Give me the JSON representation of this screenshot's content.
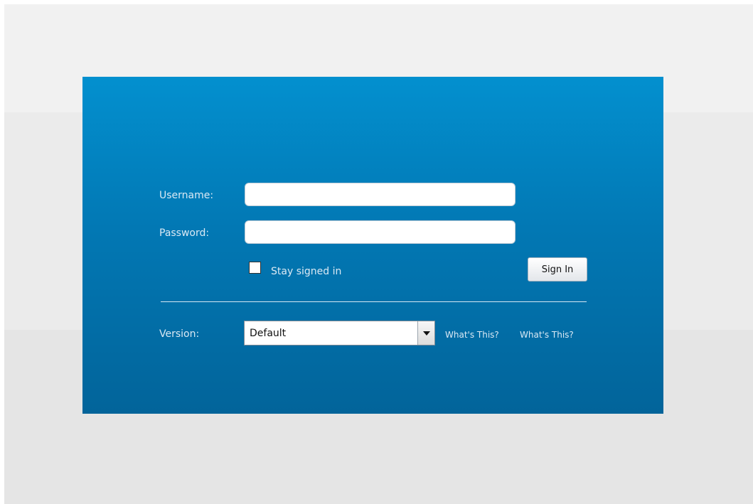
{
  "login": {
    "username_label": "Username:",
    "username_value": "",
    "password_label": "Password:",
    "password_value": "",
    "stay_signed_in_label": "Stay signed in",
    "stay_signed_in_checked": false,
    "sign_in_label": "Sign In",
    "version_label": "Version:",
    "version_selected": "Default",
    "help_links": [
      "What's This?",
      "What's This?"
    ]
  },
  "icons": {
    "dropdown": "chevron-down-icon",
    "checkbox": "checkbox-unchecked-icon"
  },
  "colors": {
    "panel_top": "#0390cf",
    "panel_bottom": "#02649a",
    "label_text": "#dbe9f4",
    "page_background": "#ebebeb"
  }
}
